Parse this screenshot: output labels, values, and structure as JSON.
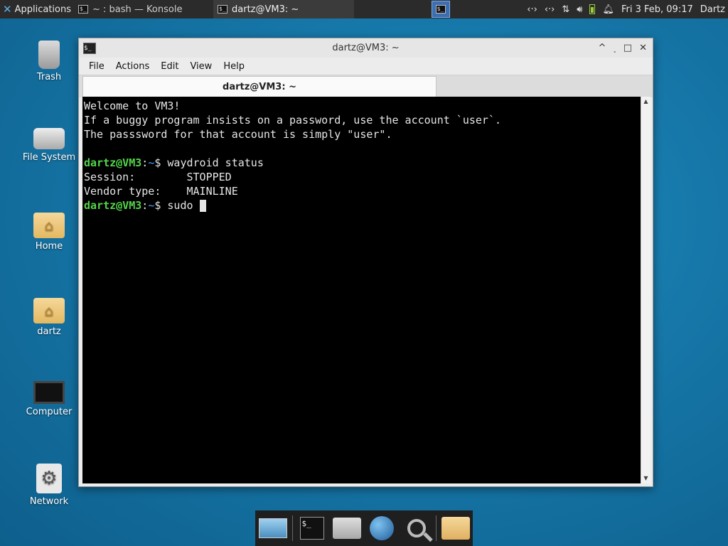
{
  "top_panel": {
    "apps_label": "Applications",
    "tasks": [
      {
        "label": "~ : bash — Konsole"
      },
      {
        "label": "dartz@VM3: ~"
      }
    ],
    "clock": "Fri  3 Feb, 09:17",
    "user": "Dartz",
    "tray_icons": [
      "network-icon",
      "network-icon-2",
      "transfer-icon",
      "volume-icon",
      "battery-icon",
      "notification-bell-icon"
    ]
  },
  "desktop_icons": [
    {
      "label": "Trash"
    },
    {
      "label": "File System"
    },
    {
      "label": "Home"
    },
    {
      "label": "dartz"
    },
    {
      "label": "Computer"
    },
    {
      "label": "Network"
    }
  ],
  "window": {
    "title": "dartz@VM3: ~",
    "menu": [
      "File",
      "Actions",
      "Edit",
      "View",
      "Help"
    ],
    "tab_title": "dartz@VM3: ~",
    "controls": {
      "raise": "^",
      "minimize": "˯",
      "maximize": "□",
      "close": "✕"
    }
  },
  "terminal": {
    "motd": [
      "Welcome to VM3!",
      "If a buggy program insists on a password, use the account `user`.",
      "The passsword for that account is simply \"user\"."
    ],
    "prompt_user": "dartz@VM3",
    "prompt_sep": ":",
    "prompt_path": "~",
    "prompt_dollar": "$ ",
    "command1": "waydroid status",
    "output": [
      "Session:        STOPPED",
      "Vendor type:    MAINLINE"
    ],
    "command2": "sudo "
  },
  "dock": {
    "items": [
      "show-desktop-icon",
      "terminal-icon",
      "home-folder-icon",
      "web-browser-icon",
      "search-icon",
      "files-icon"
    ]
  }
}
